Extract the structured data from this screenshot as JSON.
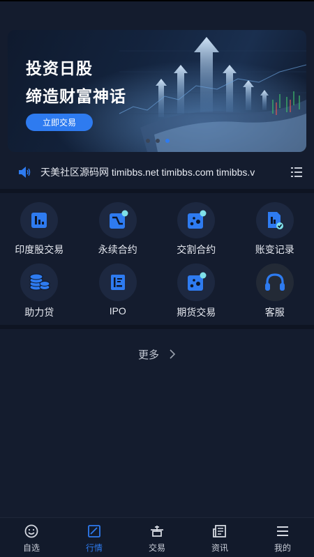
{
  "banner": {
    "title_line1": "投资日股",
    "title_line2": "缔造财富神话",
    "button_label": "立即交易",
    "page_count": 3,
    "active_page": 3
  },
  "notice": {
    "text": "天美社区源码网 timibbs.net timibbs.com timibbs.v"
  },
  "grid": [
    {
      "label": "印度股交易",
      "icon": "bar-chart-icon"
    },
    {
      "label": "永续合约",
      "icon": "trend-line-icon"
    },
    {
      "label": "交割合约",
      "icon": "dice-icon"
    },
    {
      "label": "账变记录",
      "icon": "record-check-icon"
    },
    {
      "label": "助力贷",
      "icon": "coins-icon"
    },
    {
      "label": "IPO",
      "icon": "ledger-icon"
    },
    {
      "label": "期货交易",
      "icon": "dice-icon"
    },
    {
      "label": "客服",
      "icon": "headset-icon"
    }
  ],
  "more": {
    "label": "更多"
  },
  "tabbar": [
    {
      "label": "自选",
      "icon": "smile-icon",
      "active": false
    },
    {
      "label": "行情",
      "icon": "chart-box-icon",
      "active": true
    },
    {
      "label": "交易",
      "icon": "exchange-icon",
      "active": false
    },
    {
      "label": "资讯",
      "icon": "news-icon",
      "active": false
    },
    {
      "label": "我的",
      "icon": "menu-icon",
      "active": false
    }
  ],
  "colors": {
    "accent": "#2e7bf0",
    "background": "#141c2e",
    "icon_circle": "#1d2840",
    "badge": "#7fe0e8"
  }
}
